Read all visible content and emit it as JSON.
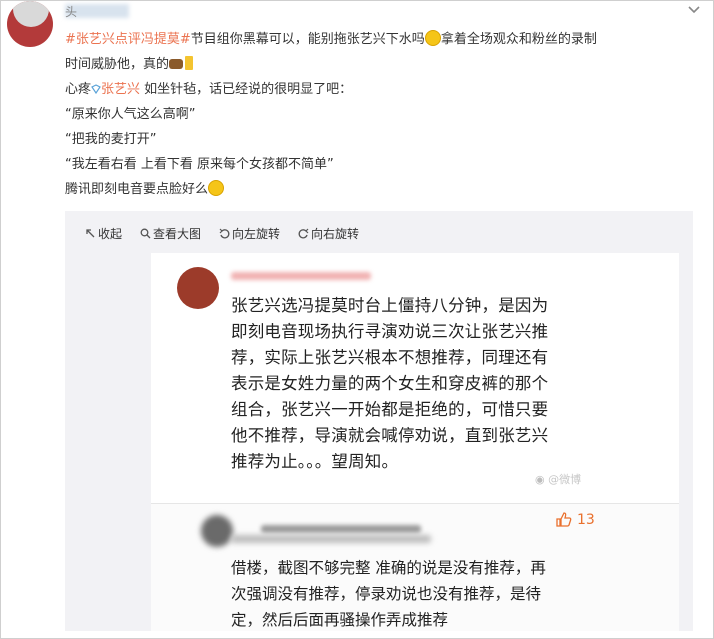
{
  "user": {
    "name_visible": "头"
  },
  "post": {
    "hashtag": "#张艺兴点评冯提莫#",
    "line1_rest": "节目组你黑幕可以，能别拖张艺兴下水吗",
    "line1_tail": "拿着全场观众和粉丝的录制",
    "line2": "时间威胁他，真的",
    "line3_prefix": "心疼",
    "line3_mention": "张艺兴",
    "line3_rest": " 如坐针毡，话已经说的很明显了吧：",
    "quote1": "“原来你人气这么高啊”",
    "quote2": "“把我的麦打开”",
    "quote3": "“我左看右看 上看下看 原来每个女孩都不简单”",
    "line_last": "腾讯即刻电音要点脸好么"
  },
  "toolbar": {
    "collapse": "收起",
    "view_large": "查看大图",
    "rotate_left": "向左旋转",
    "rotate_right": "向右旋转"
  },
  "screenshot": {
    "comment_lines": [
      "张艺兴选冯提莫时台上僵持八分钟，是因为",
      "即刻电音现场执行寻演劝说三次让张艺兴推",
      "荐，实际上张艺兴根本不想推荐，同理还有",
      "表示是女姓力量的两个女生和穿皮裤的那个",
      "组合，张艺兴一开始都是拒绝的，可惜只要",
      "他不推荐，导演就会喊停劝说，直到张艺兴",
      "推荐为止。。。望周知。"
    ],
    "watermark": "@微博",
    "like_count": "13",
    "reply_lines": [
      "借楼，截图不够完整 准确的说是没有推荐，再",
      "次强调没有推荐，停录劝说也没有推荐，是待",
      "定，然后后面再骚操作弄成推荐"
    ]
  },
  "colors": {
    "accent": "#eb7350",
    "like": "#e9702d",
    "media_bg": "#f2f2f5"
  }
}
